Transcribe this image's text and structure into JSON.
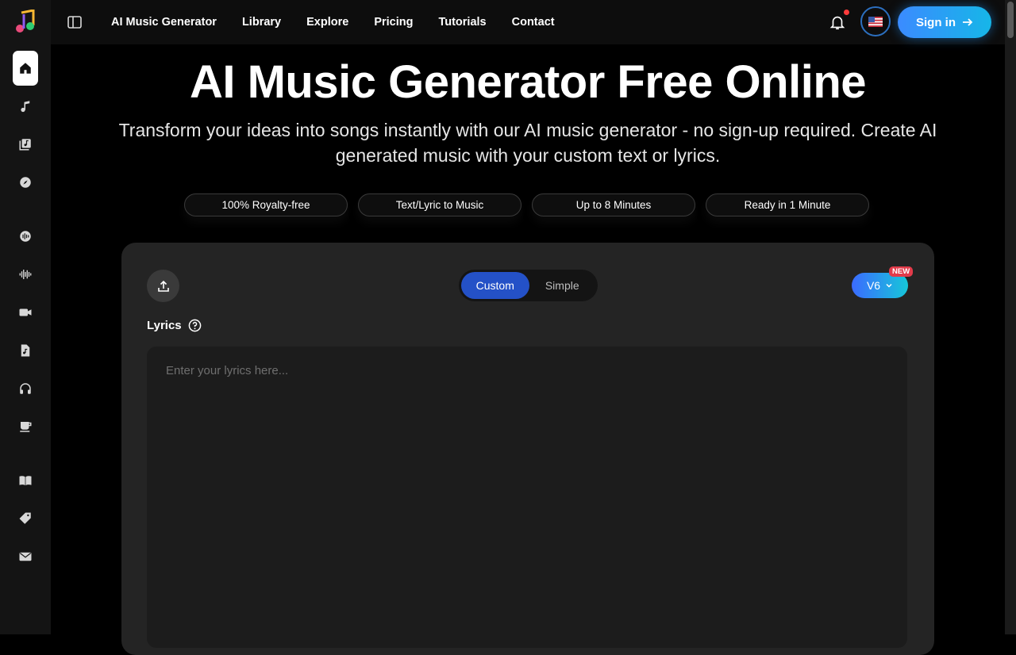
{
  "nav": {
    "links": [
      "AI Music Generator",
      "Library",
      "Explore",
      "Pricing",
      "Tutorials",
      "Contact"
    ],
    "sign_in": "Sign in"
  },
  "hero": {
    "title": "AI Music Generator Free Online",
    "subtitle": "Transform your ideas into songs instantly with our AI music generator - no sign-up required. Create AI generated music with your custom text or lyrics."
  },
  "features": [
    "100% Royalty-free",
    "Text/Lyric to Music",
    "Up to 8 Minutes",
    "Ready in 1 Minute"
  ],
  "generator": {
    "modes": [
      "Custom",
      "Simple"
    ],
    "active_mode": "Custom",
    "version": "V6",
    "version_badge": "NEW",
    "lyrics_label": "Lyrics",
    "lyrics_placeholder": "Enter your lyrics here..."
  },
  "sidebar": {
    "icons": [
      "home-icon",
      "music-note-icon",
      "library-icon",
      "compass-icon",
      "audio-split-icon",
      "waveform-icon",
      "video-icon",
      "music-file-icon",
      "headphones-icon",
      "coffee-icon",
      "book-icon",
      "tag-icon",
      "mail-icon"
    ]
  },
  "colors": {
    "accent": "#3b8bff",
    "segment_active": "#2451c7",
    "badge": "#e23b4a"
  }
}
